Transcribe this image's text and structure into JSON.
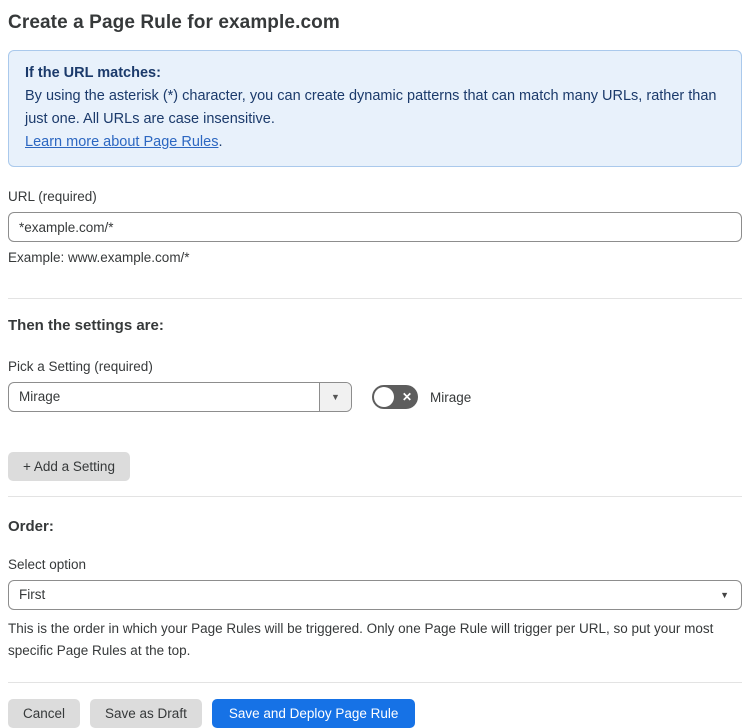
{
  "page": {
    "title": "Create a Page Rule for example.com"
  },
  "info_box": {
    "heading": "If the URL matches:",
    "body": "By using the asterisk (*) character, you can create dynamic patterns that can match many URLs, rather than just one. All URLs are case insensitive.",
    "link_label": "Learn more about Page Rules",
    "link_suffix": "."
  },
  "url_field": {
    "label": "URL (required)",
    "value": "*example.com/*",
    "helper": "Example: www.example.com/*"
  },
  "settings_section": {
    "heading": "Then the settings are:",
    "picker_label": "Pick a Setting (required)",
    "selected_setting": "Mirage",
    "caret_glyph": "▼",
    "toggle_state": "off",
    "toggle_x_glyph": "✕",
    "toggle_label": "Mirage",
    "add_setting_label": "+ Add a Setting"
  },
  "order_section": {
    "heading": "Order:",
    "select_label": "Select option",
    "selected_option": "First",
    "caret_glyph": "▼",
    "helper": "This is the order in which your Page Rules will be triggered. Only one Page Rule will trigger per URL, so put your most specific Page Rules at the top."
  },
  "footer": {
    "cancel_label": "Cancel",
    "save_draft_label": "Save as Draft",
    "save_deploy_label": "Save and Deploy Page Rule"
  },
  "colors": {
    "primary_blue": "#1672e6",
    "info_bg": "#e8f1fb",
    "info_border": "#aac9ec",
    "info_text": "#1b3a6b",
    "link_blue": "#2c67c1",
    "toggle_off_gray": "#5d5d5d"
  }
}
